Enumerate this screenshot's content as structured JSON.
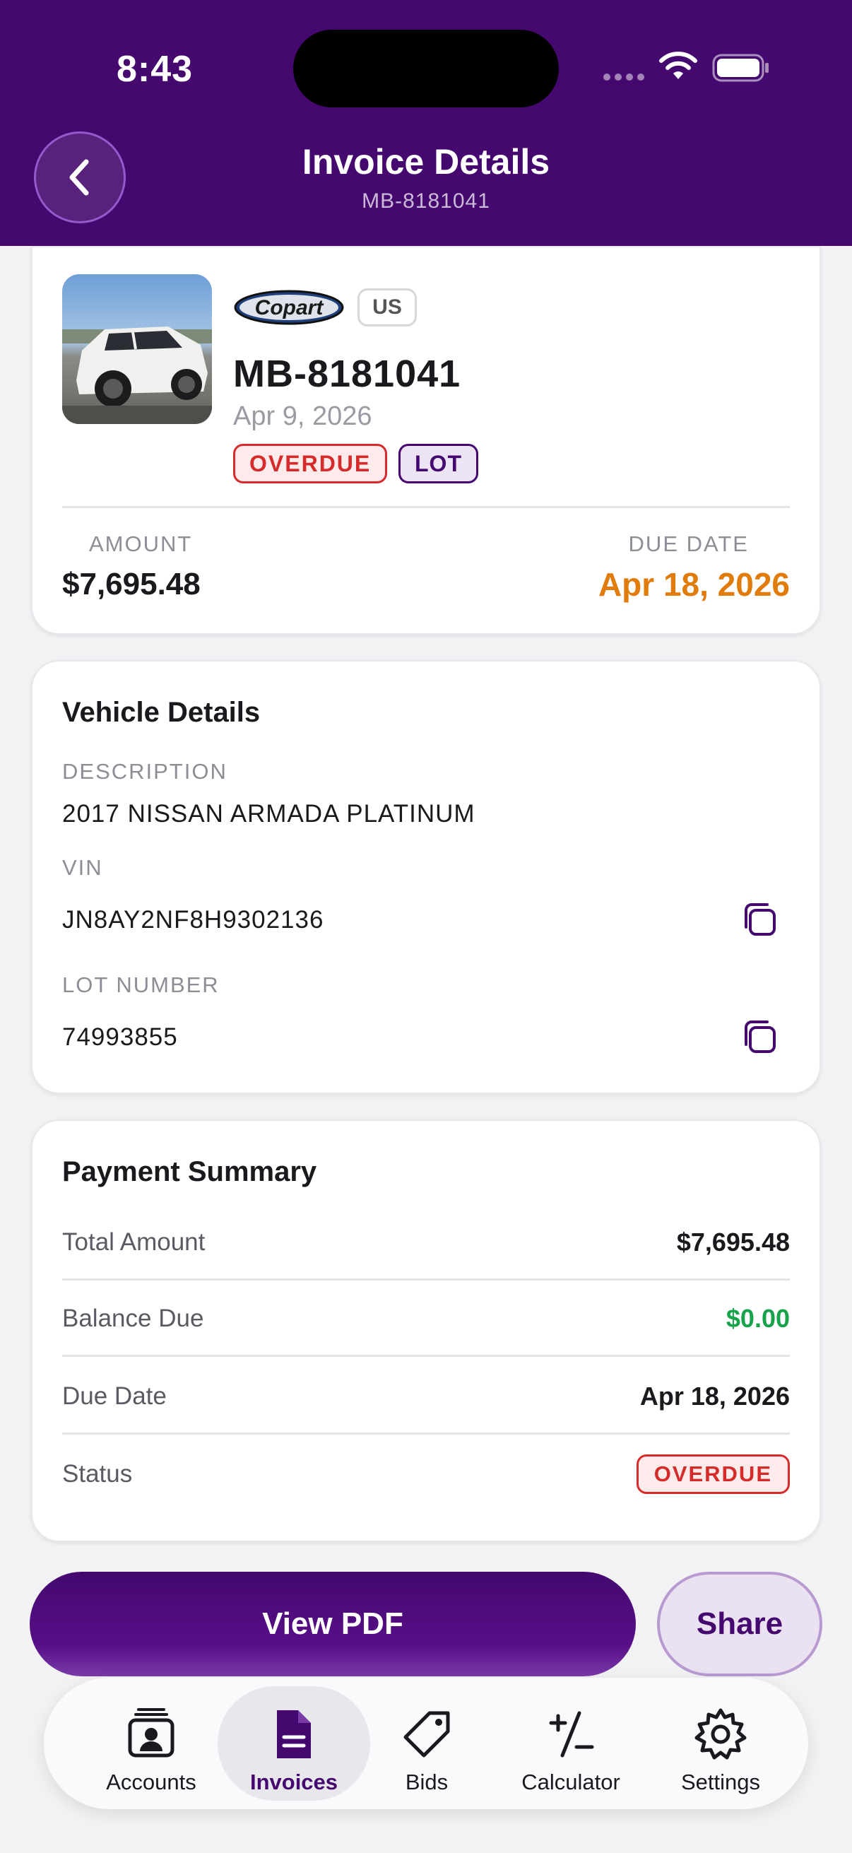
{
  "status_bar": {
    "time": "8:43"
  },
  "header": {
    "title": "Invoice Details",
    "subtitle": "MB-8181041",
    "background_color": "#44086e"
  },
  "summary": {
    "auction_logo_text": "Copart",
    "country": "US",
    "invoice_number": "MB-8181041",
    "invoice_date": "Apr 9, 2026",
    "status_badge": "OVERDUE",
    "type_badge": "LOT",
    "amount_label": "AMOUNT",
    "amount_value": "$7,695.48",
    "due_date_label": "DUE DATE",
    "due_date_value": "Apr 18, 2026"
  },
  "vehicle_details": {
    "title": "Vehicle Details",
    "description_label": "DESCRIPTION",
    "description_value": "2017 NISSAN ARMADA PLATINUM",
    "vin_label": "VIN",
    "vin_value": "JN8AY2NF8H9302136",
    "lot_label": "LOT NUMBER",
    "lot_value": "74993855"
  },
  "payment_summary": {
    "title": "Payment Summary",
    "rows": [
      {
        "label": "Total Amount",
        "value": "$7,695.48"
      },
      {
        "label": "Balance Due",
        "value": "$0.00"
      },
      {
        "label": "Due Date",
        "value": "Apr 18, 2026"
      },
      {
        "label": "Status",
        "value": "OVERDUE"
      }
    ]
  },
  "actions": {
    "view_pdf": "View PDF",
    "share": "Share"
  },
  "tab_bar": {
    "items": [
      {
        "label": "Accounts",
        "icon": "accounts-icon"
      },
      {
        "label": "Invoices",
        "icon": "invoices-icon",
        "active": true
      },
      {
        "label": "Bids",
        "icon": "tag-icon"
      },
      {
        "label": "Calculator",
        "icon": "calculator-icon"
      },
      {
        "label": "Settings",
        "icon": "gear-icon"
      }
    ]
  },
  "colors": {
    "brand": "#44086e",
    "overdue": "#d62b2b",
    "due_date": "#e07b0c",
    "balance_zero": "#16a34a"
  }
}
